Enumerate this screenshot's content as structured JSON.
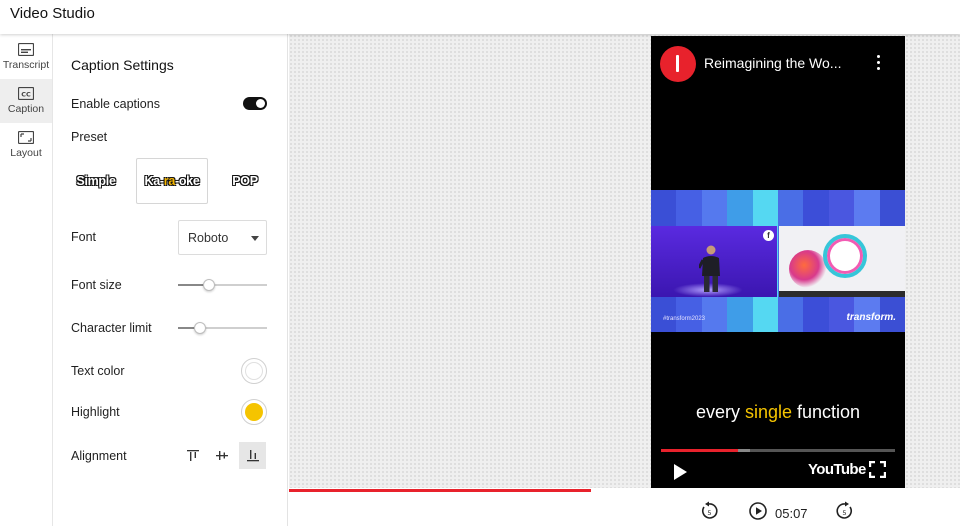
{
  "app": {
    "title": "Video Studio"
  },
  "rail": {
    "items": [
      {
        "label": "Transcript",
        "icon": "transcript-icon",
        "active": false
      },
      {
        "label": "Caption",
        "icon": "caption-icon",
        "active": true
      },
      {
        "label": "Layout",
        "icon": "layout-icon",
        "active": false
      }
    ]
  },
  "panel": {
    "title": "Caption Settings",
    "enable_captions": {
      "label": "Enable captions",
      "value": true
    },
    "preset": {
      "label": "Preset",
      "options": [
        "Simple",
        "Ka-ra-oke",
        "POP"
      ],
      "karaoke_parts": [
        "Ka-",
        "ra",
        "-oke"
      ],
      "selected": "Ka-ra-oke"
    },
    "font": {
      "label": "Font",
      "value": "Roboto"
    },
    "font_size": {
      "label": "Font size",
      "level": 0.35
    },
    "character_limit": {
      "label": "Character limit",
      "level": 0.25
    },
    "text_color": {
      "label": "Text color",
      "value": "#ffffff"
    },
    "highlight": {
      "label": "Highlight",
      "value": "#f5c400"
    },
    "alignment": {
      "label": "Alignment",
      "options": [
        "top",
        "middle",
        "bottom"
      ],
      "selected": "bottom"
    }
  },
  "preview": {
    "video_title": "Reimagining the Wo...",
    "frame": {
      "hashtag": "#transform2023",
      "brand": "transform."
    },
    "caption_parts": [
      "every",
      "single",
      "function"
    ],
    "caption_highlight_index": 1,
    "player": {
      "logo": "YouTube",
      "played": 0.33,
      "buffered": 0.38
    }
  },
  "timeline": {
    "progress": 0.45
  },
  "controls": {
    "time": "05:07"
  },
  "colors": {
    "accent": "#e8222c",
    "highlight": "#f5c400",
    "toggle_on": "#111111"
  }
}
